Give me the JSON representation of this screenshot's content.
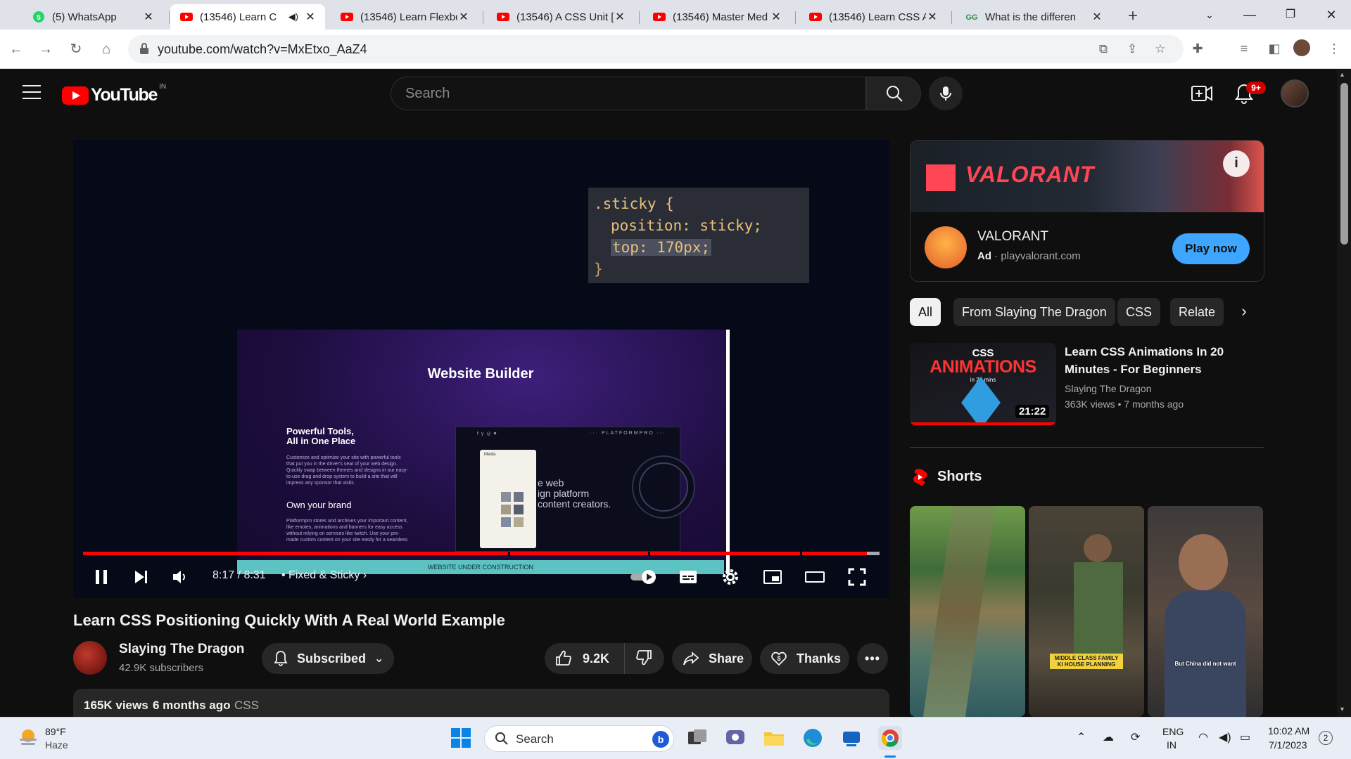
{
  "browser": {
    "tabs": [
      {
        "title": "(5) WhatsApp",
        "icon": "whatsapp-icon",
        "active": false
      },
      {
        "title": "(13546) Learn C",
        "icon": "youtube-icon",
        "active": true,
        "audio": true
      },
      {
        "title": "(13546) Learn Flexbo",
        "icon": "youtube-icon",
        "active": false
      },
      {
        "title": "(13546) A CSS Unit [",
        "icon": "youtube-icon",
        "active": false
      },
      {
        "title": "(13546) Master Med",
        "icon": "youtube-icon",
        "active": false
      },
      {
        "title": "(13546) Learn CSS A",
        "icon": "youtube-icon",
        "active": false
      },
      {
        "title": "What is the differen",
        "icon": "geeksforgeeks-icon",
        "active": false
      }
    ],
    "new_tab": "+",
    "url": "youtube.com/watch?v=MxEtxo_AaZ4",
    "colors": {
      "tabbar": "#dfe3e9",
      "omnibox": "#f1f3f4"
    }
  },
  "youtube": {
    "region": "IN",
    "logo_text": "YouTube",
    "search_placeholder": "Search",
    "notification_badge": "9+",
    "player": {
      "code_lines": [
        ".sticky {",
        "position: sticky;",
        "top: 170px;",
        "}"
      ],
      "preview": {
        "title": "Website Builder",
        "tools_heading": "Powerful Tools,\nAll in One Place",
        "tools_body": "Customize and optimize your site with powerful tools that put you in the driver's seat of your web design. Quickly swap between themes and designs in our easy-to-use drag and drop system to build a site that will impress any sponsor that visits.",
        "brand_heading": "Own your brand",
        "brand_body": "Platformpro stores and archives your important content, like emotes, animations and banners for easy access without relying on services like twitch. Use your pre-made custom content on your site easily for a seamless",
        "device_nav": "f  y  ◎  ♥",
        "device_brand": "··· PLATFORMPRO ···",
        "device_panel_title": "Media",
        "device_tagline": "e web\nign platform\ncontent creators.",
        "banner": "WEBSITE UNDER CONSTRUCTION"
      },
      "progress": {
        "played_fraction": 0.984,
        "loaded_fraction": 1.0,
        "chapter_fractions": [
          0.534,
          0.709,
          0.9
        ]
      },
      "current_time": "8:17",
      "duration": "8:31",
      "time_display": "8:17 / 8:31",
      "chapter": "Fixed & Sticky",
      "autoplay": true
    },
    "video": {
      "title": "Learn CSS Positioning Quickly With A Real World Example",
      "channel": "Slaying The Dragon",
      "subscribers": "42.9K subscribers",
      "subscribe_label": "Subscribed",
      "likes": "9.2K",
      "share_label": "Share",
      "thanks_label": "Thanks",
      "views": "165K views",
      "age": "6 months ago",
      "tag": "CSS"
    },
    "ad": {
      "banner_text": "VALORANT",
      "name": "VALORANT",
      "ad_label": "Ad",
      "domain": "playvalorant.com",
      "cta": "Play now",
      "brand_color": "#ff4655"
    },
    "chips": [
      "All",
      "From Slaying The Dragon",
      "CSS",
      "Relate"
    ],
    "recommendation": {
      "title": "Learn CSS Animations In 20 Minutes - For Beginners",
      "channel": "Slaying The Dragon",
      "views": "363K views",
      "age": "7 months ago",
      "duration": "21:22",
      "thumb_css": "CSS",
      "thumb_animations": "ANIMATIONS",
      "thumb_mins": "in 20 mins"
    },
    "shorts": {
      "label": "Shorts",
      "items": [
        {
          "caption": ""
        },
        {
          "caption": "MIDDLE CLASS FAMILY\nKI HOUSE PLANNING"
        },
        {
          "caption": "But China did not want"
        }
      ]
    },
    "colors": {
      "background": "#0f0f0f",
      "accent_red": "#ff0000",
      "cta_blue": "#3ea6ff"
    }
  },
  "taskbar": {
    "weather": {
      "temp": "89°F",
      "condition": "Haze"
    },
    "search_label": "Search",
    "language": [
      "ENG",
      "IN"
    ],
    "time": "10:02 AM",
    "date": "7/1/2023",
    "notifications": "2"
  }
}
